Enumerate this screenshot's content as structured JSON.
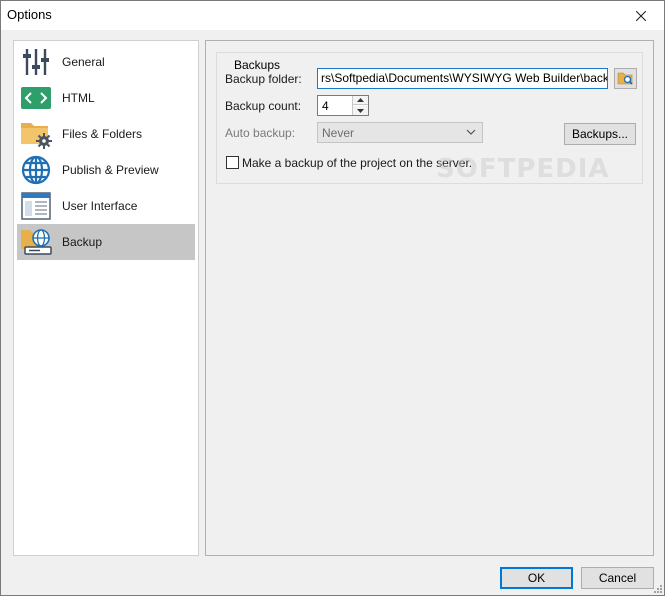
{
  "window": {
    "title": "Options",
    "close_symbol": "✕"
  },
  "sidebar": {
    "items": [
      {
        "label": "General",
        "icon": "sliders-icon"
      },
      {
        "label": "HTML",
        "icon": "html-code-icon"
      },
      {
        "label": "Files & Folders",
        "icon": "folder-gear-icon"
      },
      {
        "label": "Publish & Preview",
        "icon": "globe-icon"
      },
      {
        "label": "User Interface",
        "icon": "window-layout-icon"
      },
      {
        "label": "Backup",
        "icon": "backup-globe-icon",
        "selected": true
      }
    ]
  },
  "backups": {
    "group_title": "Backups",
    "folder_label": "Backup folder:",
    "folder_value": "rs\\Softpedia\\Documents\\WYSIWYG Web Builder\\backups",
    "count_label": "Backup count:",
    "count_value": "4",
    "auto_label": "Auto backup:",
    "auto_value": "Never",
    "backups_button": "Backups...",
    "server_checkbox_label": "Make a backup of the project on the server.",
    "server_checkbox_checked": false
  },
  "watermark": "SOFTPEDIA",
  "footer": {
    "ok_label": "OK",
    "cancel_label": "Cancel"
  },
  "colors": {
    "accent": "#0078d7",
    "selected_item": "#c6c6c6",
    "html_icon": "#2e9e6a",
    "globe_icon": "#1f6fb5",
    "folder_icon": "#e8b04a"
  }
}
